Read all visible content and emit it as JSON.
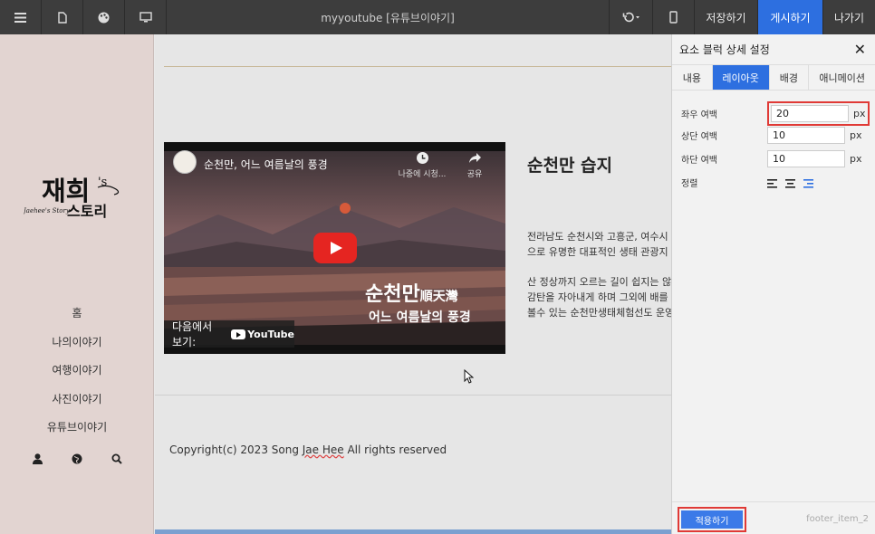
{
  "toolbar": {
    "title": "myyoutube [유튜브이야기]",
    "save_label": "저장하기",
    "publish_label": "게시하기",
    "exit_label": "나가기",
    "icons": [
      "menu-icon",
      "document-icon",
      "palette-icon",
      "desktop-icon",
      "undo-icon",
      "mobile-icon"
    ]
  },
  "sidebar": {
    "logo": {
      "text_main": "재희",
      "text_suffix": "'s",
      "text_sub": "스토리",
      "text_script": "Jaehee's Story"
    },
    "nav": [
      {
        "label": "홈"
      },
      {
        "label": "나의이야기"
      },
      {
        "label": "여행이야기"
      },
      {
        "label": "사진이야기"
      },
      {
        "label": "유튜브이야기"
      }
    ],
    "icons": [
      "user-icon",
      "globe-icon",
      "search-icon"
    ]
  },
  "content": {
    "video": {
      "title": "순천만, 어느 여름날의 풍경",
      "watch_later": "나중에 시청...",
      "share": "공유",
      "caption_main": "순천만",
      "caption_hanja": "順天灣",
      "caption_sub": "어느 여름날의 풍경",
      "watch_on": "다음에서 보기:",
      "youtube": "YouTube"
    },
    "heading": "순천만 습지",
    "paragraph1": [
      "전라남도 순천시와 고흥군, 여수시",
      "으로 유명한 대표적인 생태 관광지"
    ],
    "paragraph2": [
      "산 정상까지 오르는 길이 쉽지는 않",
      "감탄을 자아내게 하며 그외에 배를",
      "볼수 있는 순천만생태체험선도 운영"
    ],
    "footer_prefix": "Copyright(c) 2023 Song ",
    "footer_name": "Jae Hee",
    "footer_suffix": " All rights reserved"
  },
  "panel": {
    "title": "요소 블럭 상세 설정",
    "tabs": [
      {
        "label": "내용",
        "active": false
      },
      {
        "label": "레이아웃",
        "active": true
      },
      {
        "label": "배경",
        "active": false
      },
      {
        "label": "애니메이션",
        "active": false
      }
    ],
    "fields": {
      "lr_margin": {
        "label": "좌우 여백",
        "value": "20",
        "unit": "px"
      },
      "top_margin": {
        "label": "상단 여백",
        "value": "10",
        "unit": "px"
      },
      "bottom_margin": {
        "label": "하단 여백",
        "value": "10",
        "unit": "px"
      },
      "align": {
        "label": "정렬",
        "selected": "right"
      }
    },
    "apply_label": "적용하기",
    "item_id": "footer_item_2"
  },
  "colors": {
    "accent": "#2d6fe0",
    "highlight": "#e03a36",
    "sidebar_bg": "#e2d4d1",
    "toolbar_bg": "#3d3d3d"
  }
}
